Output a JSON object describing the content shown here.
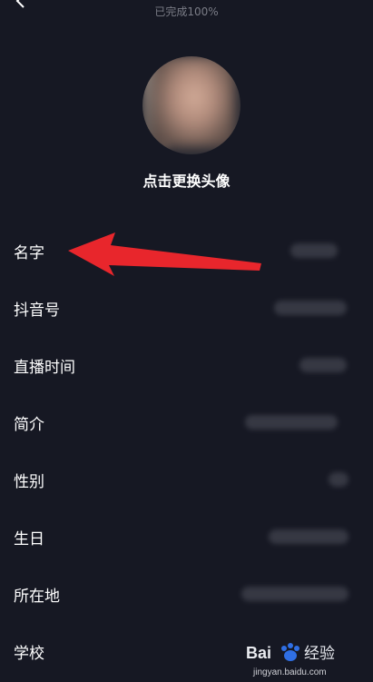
{
  "header": {
    "progress_text": "已完成100%"
  },
  "avatar": {
    "label": "点击更换头像"
  },
  "fields": [
    {
      "label": "名字"
    },
    {
      "label": "抖音号"
    },
    {
      "label": "直播时间"
    },
    {
      "label": "简介"
    },
    {
      "label": "性别"
    },
    {
      "label": "生日"
    },
    {
      "label": "所在地"
    },
    {
      "label": "学校"
    }
  ],
  "watermark": {
    "url": "jingyan.baidu.com"
  },
  "colors": {
    "background": "#161823",
    "annotation_arrow": "#e8262c"
  }
}
